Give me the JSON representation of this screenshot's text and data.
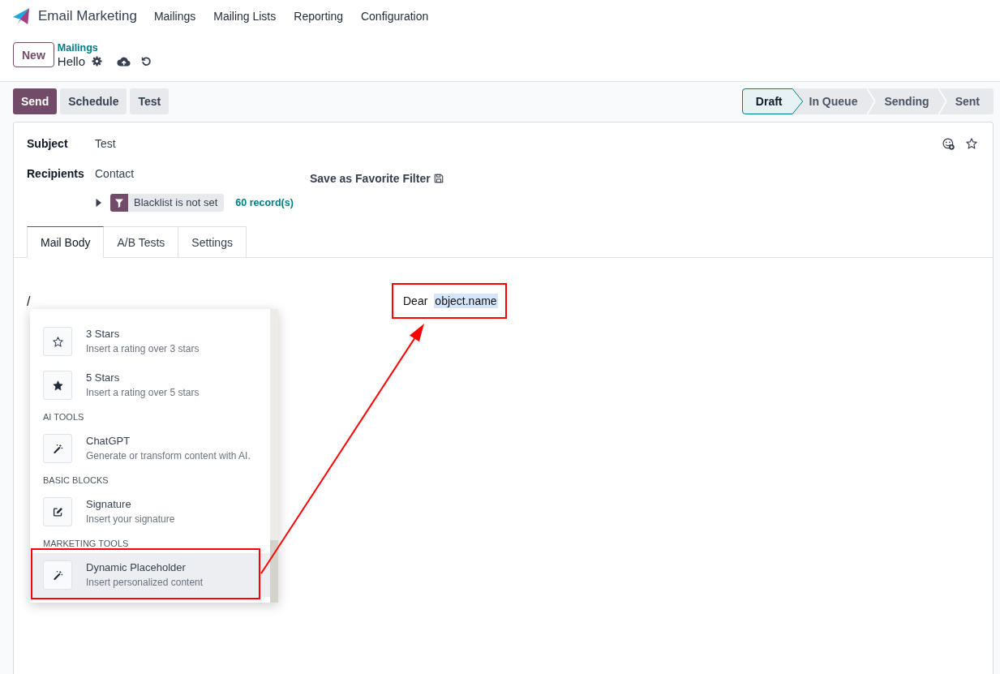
{
  "app": {
    "name": "Email Marketing",
    "menu": [
      {
        "label": "Mailings"
      },
      {
        "label": "Mailing Lists"
      },
      {
        "label": "Reporting"
      },
      {
        "label": "Configuration"
      }
    ]
  },
  "control_panel": {
    "new_button": "New",
    "breadcrumb": "Mailings",
    "record_title": "Hello"
  },
  "actions": [
    {
      "label": "Send",
      "kind": "primary"
    },
    {
      "label": "Schedule",
      "kind": "secondary"
    },
    {
      "label": "Test",
      "kind": "secondary"
    }
  ],
  "status_bar": [
    {
      "label": "Draft",
      "selected": true
    },
    {
      "label": "In Queue",
      "selected": false
    },
    {
      "label": "Sending",
      "selected": false
    },
    {
      "label": "Sent",
      "selected": false
    }
  ],
  "form": {
    "favorite": false,
    "fields": [
      {
        "label": "Subject",
        "value": "Test",
        "kind": "text"
      },
      {
        "label": "Recipients",
        "value": "Contact",
        "kind": "domain",
        "save_filter": "Save as Favorite Filter",
        "filter": {
          "expanded": false,
          "tag": "Blacklist is not set",
          "count": "60 record(s)"
        }
      }
    ]
  },
  "tabs": [
    {
      "label": "Mail Body",
      "selected": true
    },
    {
      "label": "A/B Tests",
      "selected": false
    },
    {
      "label": "Settings",
      "selected": false
    }
  ],
  "editor": {
    "text": "/"
  },
  "powerbox": {
    "groups": [
      {
        "items": [
          {
            "title": "3 Stars",
            "description": "Insert a rating over 3 stars",
            "kind": "rating3",
            "selected": false,
            "annotated": false
          },
          {
            "title": "5 Stars",
            "description": "Insert a rating over 5 stars",
            "kind": "rating5",
            "selected": false,
            "annotated": false
          }
        ]
      },
      {
        "category": "AI TOOLS",
        "items": [
          {
            "title": "ChatGPT",
            "description": "Generate or transform content with AI.",
            "kind": "ai",
            "selected": false,
            "annotated": false
          }
        ]
      },
      {
        "category": "BASIC BLOCKS",
        "items": [
          {
            "title": "Signature",
            "description": "Insert your signature",
            "kind": "signature",
            "selected": false,
            "annotated": false
          }
        ]
      },
      {
        "category": "MARKETING TOOLS",
        "items": [
          {
            "title": "Dynamic Placeholder",
            "description": "Insert personalized content",
            "kind": "dynamic",
            "selected": true,
            "annotated": true
          }
        ]
      }
    ]
  },
  "callout": {
    "text": "Dear",
    "token": "object.name"
  }
}
